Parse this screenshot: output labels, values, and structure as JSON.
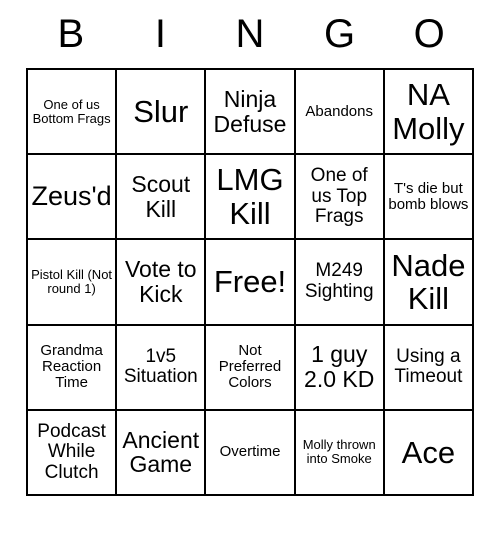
{
  "card": {
    "headers": [
      "B",
      "I",
      "N",
      "G",
      "O"
    ],
    "cells": [
      {
        "text": "One of us Bottom Frags",
        "size": "fs-xs"
      },
      {
        "text": "Slur",
        "size": "fs-xxl"
      },
      {
        "text": "Ninja Defuse",
        "size": "fs-l"
      },
      {
        "text": "Abandons",
        "size": "fs-s"
      },
      {
        "text": "NA Molly",
        "size": "fs-xxl"
      },
      {
        "text": "Zeus'd",
        "size": "fs-xl"
      },
      {
        "text": "Scout Kill",
        "size": "fs-l"
      },
      {
        "text": "LMG Kill",
        "size": "fs-xxl"
      },
      {
        "text": "One of us Top Frags",
        "size": "fs-m"
      },
      {
        "text": "T's die but bomb blows",
        "size": "fs-s"
      },
      {
        "text": "Pistol Kill (Not round 1)",
        "size": "fs-xs"
      },
      {
        "text": "Vote to Kick",
        "size": "fs-l"
      },
      {
        "text": "Free!",
        "size": "fs-xxl"
      },
      {
        "text": "M249 Sighting",
        "size": "fs-m"
      },
      {
        "text": "Nade Kill",
        "size": "fs-xxl"
      },
      {
        "text": "Grandma Reaction Time",
        "size": "fs-s"
      },
      {
        "text": "1v5 Situation",
        "size": "fs-m"
      },
      {
        "text": "Not Preferred Colors",
        "size": "fs-s"
      },
      {
        "text": "1 guy 2.0 KD",
        "size": "fs-l"
      },
      {
        "text": "Using a Timeout",
        "size": "fs-m"
      },
      {
        "text": "Podcast While Clutch",
        "size": "fs-m"
      },
      {
        "text": "Ancient Game",
        "size": "fs-l"
      },
      {
        "text": "Overtime",
        "size": "fs-s"
      },
      {
        "text": "Molly thrown into Smoke",
        "size": "fs-xs"
      },
      {
        "text": "Ace",
        "size": "fs-xxl"
      }
    ]
  }
}
